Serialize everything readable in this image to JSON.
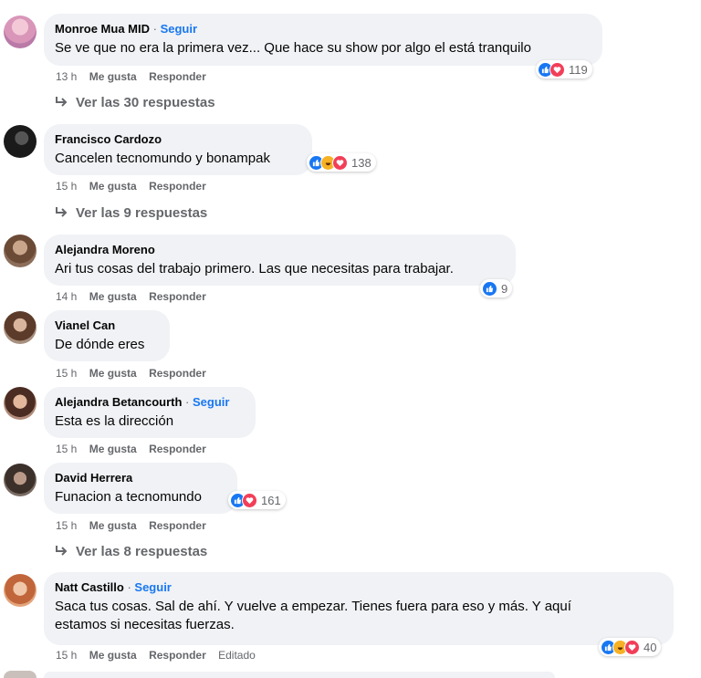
{
  "colors": {
    "accent": "#1877f2",
    "bubble": "#f0f2f5",
    "muted": "#65676b",
    "love": "#f33e58",
    "haha": "#f7b125"
  },
  "comments": [
    {
      "author": "Monroe Mua MID",
      "follow": "Seguir",
      "text": "Se ve que no era la primera vez... Que hace su show por algo el está tranquilo",
      "time": "13 h",
      "like_label": "Me gusta",
      "reply_label": "Responder",
      "reactions": [
        "like",
        "love"
      ],
      "reaction_count": "119",
      "replies_label": "Ver las 30 respuestas"
    },
    {
      "author": "Francisco Cardozo",
      "text": "Cancelen tecnomundo y bonampak",
      "time": "15 h",
      "like_label": "Me gusta",
      "reply_label": "Responder",
      "reactions": [
        "like",
        "haha",
        "love"
      ],
      "reaction_count": "138",
      "replies_label": "Ver las 9 respuestas"
    },
    {
      "author": "Alejandra Moreno",
      "text": "Ari tus cosas del trabajo primero. Las que necesitas para trabajar.",
      "time": "14 h",
      "like_label": "Me gusta",
      "reply_label": "Responder",
      "reactions": [
        "like"
      ],
      "reaction_count": "9"
    },
    {
      "author": "Vianel Can",
      "text": "De dónde eres",
      "time": "15 h",
      "like_label": "Me gusta",
      "reply_label": "Responder"
    },
    {
      "author": "Alejandra Betancourth",
      "follow": "Seguir",
      "text": "Esta es la dirección",
      "time": "15 h",
      "like_label": "Me gusta",
      "reply_label": "Responder"
    },
    {
      "author": "David Herrera",
      "text": "Funacion a tecnomundo",
      "time": "15 h",
      "like_label": "Me gusta",
      "reply_label": "Responder",
      "reactions": [
        "like",
        "love"
      ],
      "reaction_count": "161",
      "replies_label": "Ver las 8 respuestas"
    },
    {
      "author": "Natt Castillo",
      "follow": "Seguir",
      "text_line1": "Saca tus cosas. Sal de ahí. Y vuelve a empezar. Tienes fuera para eso y más. Y aquí",
      "text_line2": "estamos si necesitas fuerzas.",
      "time": "15 h",
      "like_label": "Me gusta",
      "reply_label": "Responder",
      "edited": "Editado",
      "reactions": [
        "like",
        "haha",
        "love"
      ],
      "reaction_count": "40"
    }
  ]
}
